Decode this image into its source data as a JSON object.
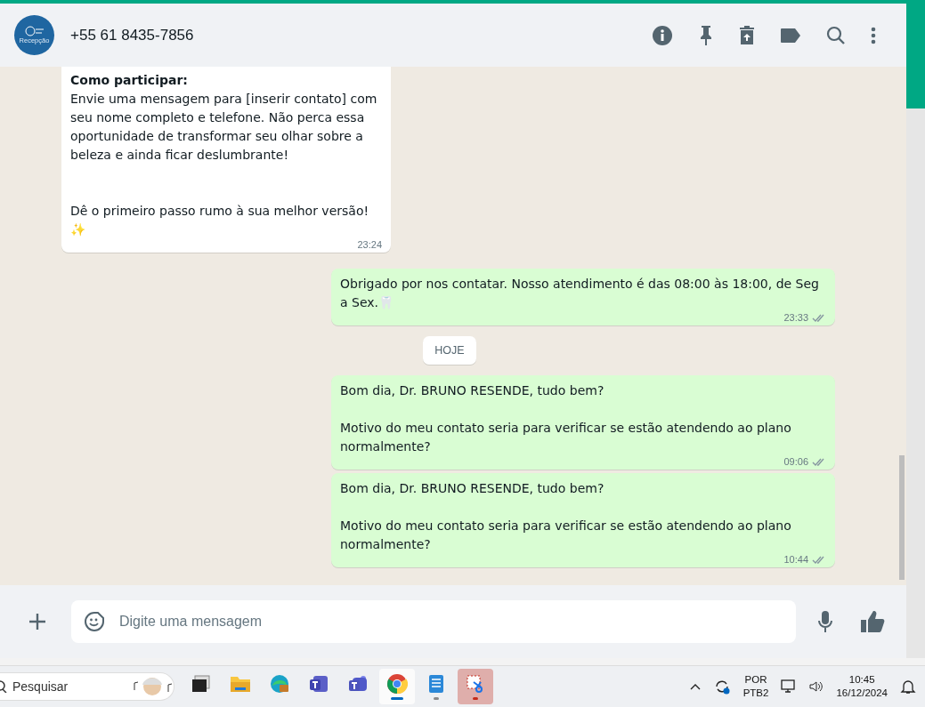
{
  "header": {
    "contact": "+55 61 8435-7856",
    "avatar_label": "Recepção"
  },
  "messages": [
    {
      "kind": "incoming",
      "paragraphs": [
        "**Como participar:**\nEnvie uma mensagem para [inserir contato] com seu nome completo e telefone. Não perca essa oportunidade de transformar seu olhar sobre a beleza e ainda ficar deslumbrante!",
        "Dê o primeiro passo rumo à sua melhor versão!\n✨"
      ],
      "time": "23:24"
    },
    {
      "kind": "outgoing",
      "paragraphs": [
        "Obrigado por nos contatar. Nosso atendimento é das 08:00 às 18:00, de Seg a Sex.🦷"
      ],
      "time": "23:33",
      "double_check": true
    },
    {
      "kind": "date",
      "label": "HOJE"
    },
    {
      "kind": "outgoing",
      "paragraphs": [
        "Bom dia, Dr. BRUNO RESENDE, tudo bem?",
        "Motivo do meu contato seria para verificar se estão atendendo ao plano normalmente?"
      ],
      "time": "09:06",
      "double_check": true
    },
    {
      "kind": "outgoing",
      "paragraphs": [
        "Bom dia, Dr. BRUNO RESENDE, tudo bem?",
        "Motivo do meu contato seria para verificar se estão atendendo ao plano normalmente?"
      ],
      "time": "10:44",
      "double_check": true
    }
  ],
  "composer": {
    "placeholder": "Digite uma mensagem"
  },
  "taskbar": {
    "search_placeholder": "Pesquisar",
    "apps": [
      {
        "kind": "taskview",
        "selected": false,
        "running": false
      },
      {
        "kind": "files",
        "selected": false,
        "running": false
      },
      {
        "kind": "edge",
        "selected": false,
        "running": false
      },
      {
        "kind": "teams",
        "selected": false,
        "running": false
      },
      {
        "kind": "teams2",
        "selected": false,
        "running": false
      },
      {
        "kind": "chrome",
        "selected": true,
        "running": true
      },
      {
        "kind": "notepad",
        "selected": false,
        "running": true
      },
      {
        "kind": "snip",
        "selected": false,
        "running": true,
        "color": "#c42b1c"
      }
    ],
    "language": "POR",
    "layout": "PTB2",
    "time": "10:45",
    "date": "16/12/2024"
  }
}
